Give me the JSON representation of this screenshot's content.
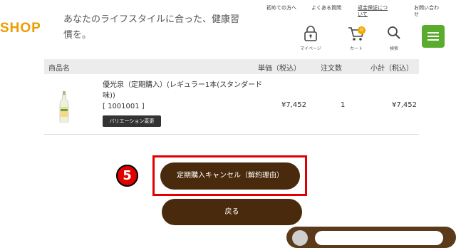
{
  "header": {
    "logo": "SHOP",
    "tagline": "あなたのライフスタイルに合った、健康習慣を。",
    "links": {
      "beginners": "初めての方へ",
      "faq": "よくある質問",
      "guarantee": "返金保証について",
      "contact": "お問い合わせ"
    },
    "mypage_label": "マイページ",
    "cart_label": "カート",
    "cart_count": "0",
    "search_label": "検索"
  },
  "table": {
    "columns": {
      "product": "商品名",
      "unit_price": "単価（税込）",
      "quantity": "注文数",
      "subtotal": "小計（税込）"
    },
    "rows": [
      {
        "name": "優光泉（定期購入）(レギュラー1本(スタンダード味))",
        "code": "[ 1001001 ]",
        "variation_button": "バリエーション変更",
        "unit_price": "¥7,452",
        "quantity": "1",
        "subtotal": "¥7,452"
      }
    ]
  },
  "step_number": "5",
  "buttons": {
    "cancel": "定期購入キャンセル（解約理由）",
    "back": "戻る"
  },
  "colors": {
    "button": "#4a2a0c",
    "highlight": "#e00000",
    "menu": "#5aac2e",
    "logo": "#ee9b00"
  }
}
